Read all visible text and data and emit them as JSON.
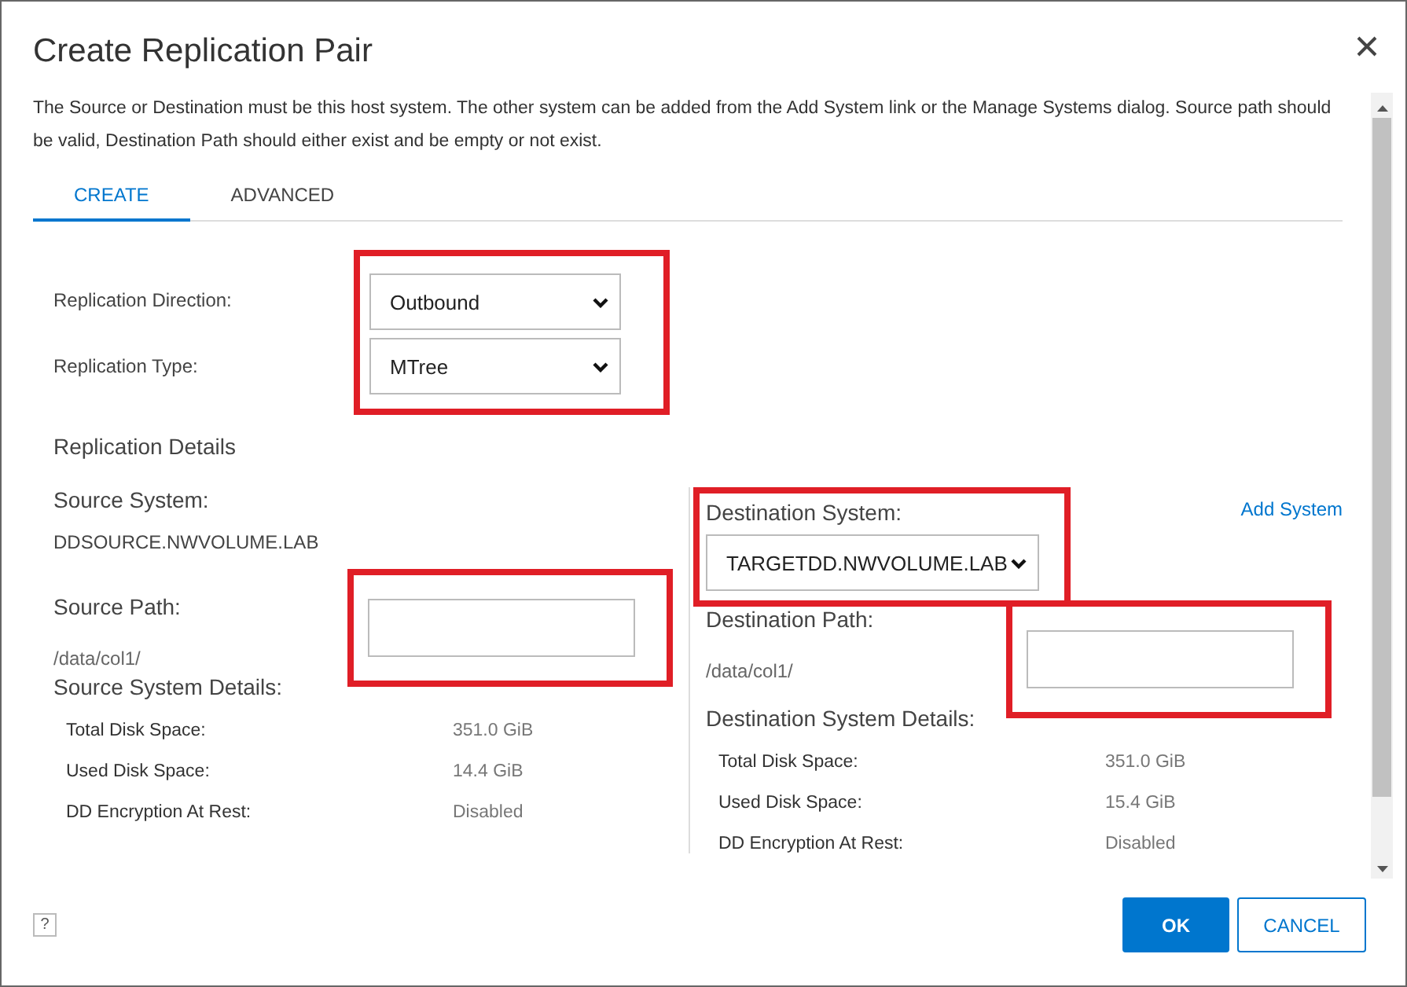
{
  "dialog": {
    "title": "Create Replication Pair",
    "description": "The Source or Destination must be this host system. The other system can be added from the Add System link or the Manage Systems dialog. Source path should be valid, Destination Path should either exist and be empty or not exist."
  },
  "tabs": [
    {
      "label": "CREATE",
      "selected": true
    },
    {
      "label": "ADVANCED",
      "selected": false
    }
  ],
  "settings": {
    "highlighted": true,
    "fields": [
      {
        "label": "Replication Direction:",
        "value": "Outbound"
      },
      {
        "label": "Replication Type:",
        "value": "MTree"
      }
    ]
  },
  "details_heading": "Replication Details",
  "source": {
    "system_label": "Source System:",
    "system": "DDSOURCE.NWVOLUME.LAB",
    "path_label": "Source Path:",
    "path": "/data/col1/",
    "path_field_highlighted": true,
    "details_label": "Source System Details:",
    "details": [
      {
        "label": "Total Disk Space:",
        "value": "351.0 GiB"
      },
      {
        "label": "Used Disk Space:",
        "value": "14.4 GiB"
      },
      {
        "label": "DD Encryption At Rest:",
        "value": "Disabled"
      }
    ]
  },
  "destination": {
    "system_label": "Destination System:",
    "system": "TARGETDD.NWVOLUME.LAB",
    "system_highlighted": true,
    "add_link": "Add System",
    "path_label": "Destination Path:",
    "path": "/data/col1/",
    "path_field_highlighted": true,
    "details_label": "Destination System Details:",
    "details": [
      {
        "label": "Total Disk Space:",
        "value": "351.0 GiB"
      },
      {
        "label": "Used Disk Space:",
        "value": "15.4 GiB"
      },
      {
        "label": "DD Encryption At Rest:",
        "value": "Disabled"
      }
    ]
  },
  "footer": {
    "help": "?",
    "buttons": [
      {
        "label": "OK",
        "kind": "primary"
      },
      {
        "label": "CANCEL",
        "kind": "secondary"
      }
    ]
  }
}
